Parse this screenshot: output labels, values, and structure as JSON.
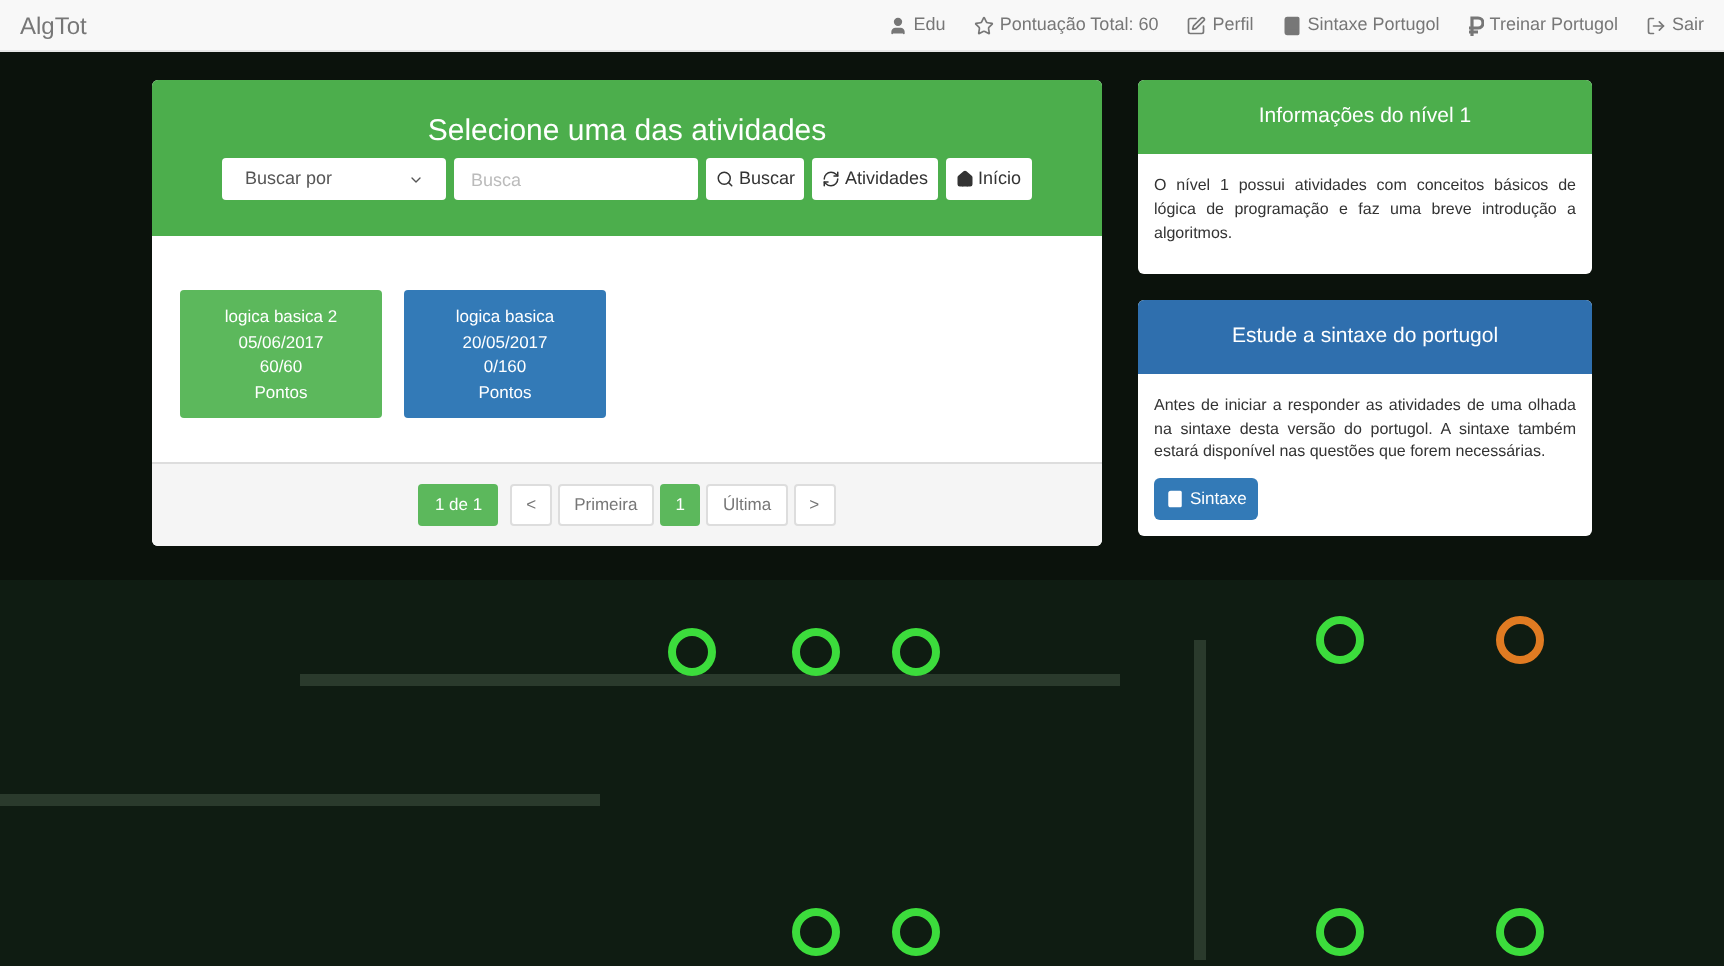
{
  "navbar": {
    "brand": "AlgTot",
    "items": [
      {
        "kind": "user",
        "label": "Edu"
      },
      {
        "kind": "star",
        "label": "Pontuação Total: 60"
      },
      {
        "kind": "edit",
        "label": "Perfil"
      },
      {
        "kind": "book",
        "label": "Sintaxe Portugol"
      },
      {
        "kind": "train",
        "label": "Treinar Portugol"
      },
      {
        "kind": "logout",
        "label": "Sair"
      }
    ]
  },
  "activities_panel": {
    "title": "Selecione uma das atividades",
    "search_by": {
      "value": "Buscar por"
    },
    "search": {
      "placeholder": "Busca"
    },
    "buttons": [
      {
        "kind": "search",
        "label": "Buscar"
      },
      {
        "kind": "refresh",
        "label": "Atividades"
      },
      {
        "kind": "home",
        "label": "Início"
      }
    ],
    "activities": [
      {
        "name": "logica basica 2",
        "date": "05/06/2017",
        "score": "60/60",
        "unit": "Pontos",
        "color": "#5cb85c"
      },
      {
        "name": "logica basica",
        "date": "20/05/2017",
        "score": "0/160",
        "unit": "Pontos",
        "color": "#337ab7"
      }
    ],
    "pagination": {
      "summary": "1 de 1",
      "items": [
        {
          "label": "<",
          "selected": false
        },
        {
          "label": "Primeira",
          "selected": false
        },
        {
          "label": "1",
          "selected": true
        },
        {
          "label": "Última",
          "selected": false
        },
        {
          "label": ">",
          "selected": false
        }
      ]
    }
  },
  "level_info": {
    "title": "Informações do nível 1",
    "text": "O nível 1 possui atividades com conceitos básicos de lógica de programação e faz uma breve introdução a algoritmos."
  },
  "syntax_panel": {
    "title": "Estude a sintaxe do portugol",
    "text": "Antes de iniciar a responder as atividades de uma olhada na sintaxe desta versão do portugol. A sintaxe também estará disponível nas questões que forem necessárias.",
    "button": "Sintaxe"
  }
}
